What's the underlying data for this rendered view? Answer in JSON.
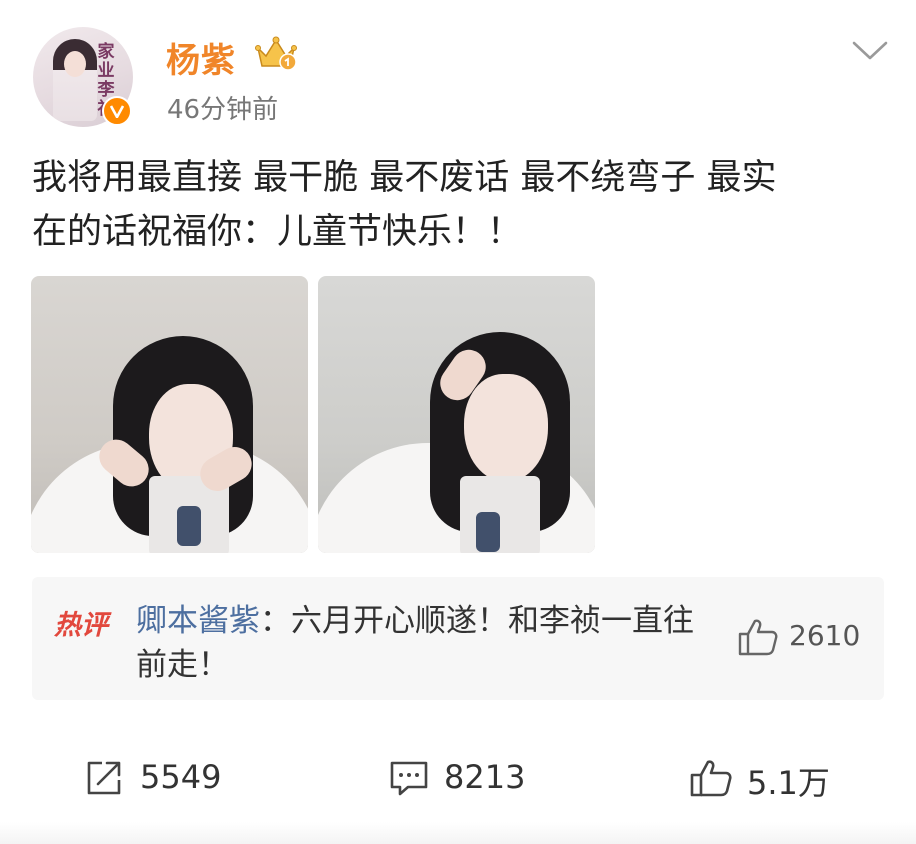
{
  "post": {
    "author": {
      "name": "杨紫",
      "avatar_text": "家业李祯",
      "avatar_icon": "avatar-portrait",
      "verified_icon": "verified-v-icon",
      "badge_icon": "crown-icon"
    },
    "timestamp": "46分钟前",
    "text_line1": "我将用最直接 最干脆 最不废话 最不绕弯子 最实",
    "text_line2": "在的话祝福你：儿童节快乐！！",
    "images": [
      {
        "name": "post-photo-1"
      },
      {
        "name": "post-photo-2"
      }
    ]
  },
  "hot_comment": {
    "badge": "热评",
    "author": "卿本酱紫",
    "separator": "：",
    "text": "六月开心顺遂！和李祯一直往前走！",
    "likes": "2610"
  },
  "actions": {
    "repost": {
      "icon": "share-icon",
      "count": "5549"
    },
    "comment": {
      "icon": "comment-icon",
      "count": "8213"
    },
    "like": {
      "icon": "thumbs-up-icon",
      "count": "5.1万"
    }
  },
  "colors": {
    "username": "#f08529",
    "hot_badge": "#e2483d",
    "comment_author": "#4d6fa0",
    "verified": "#ff8a00"
  }
}
